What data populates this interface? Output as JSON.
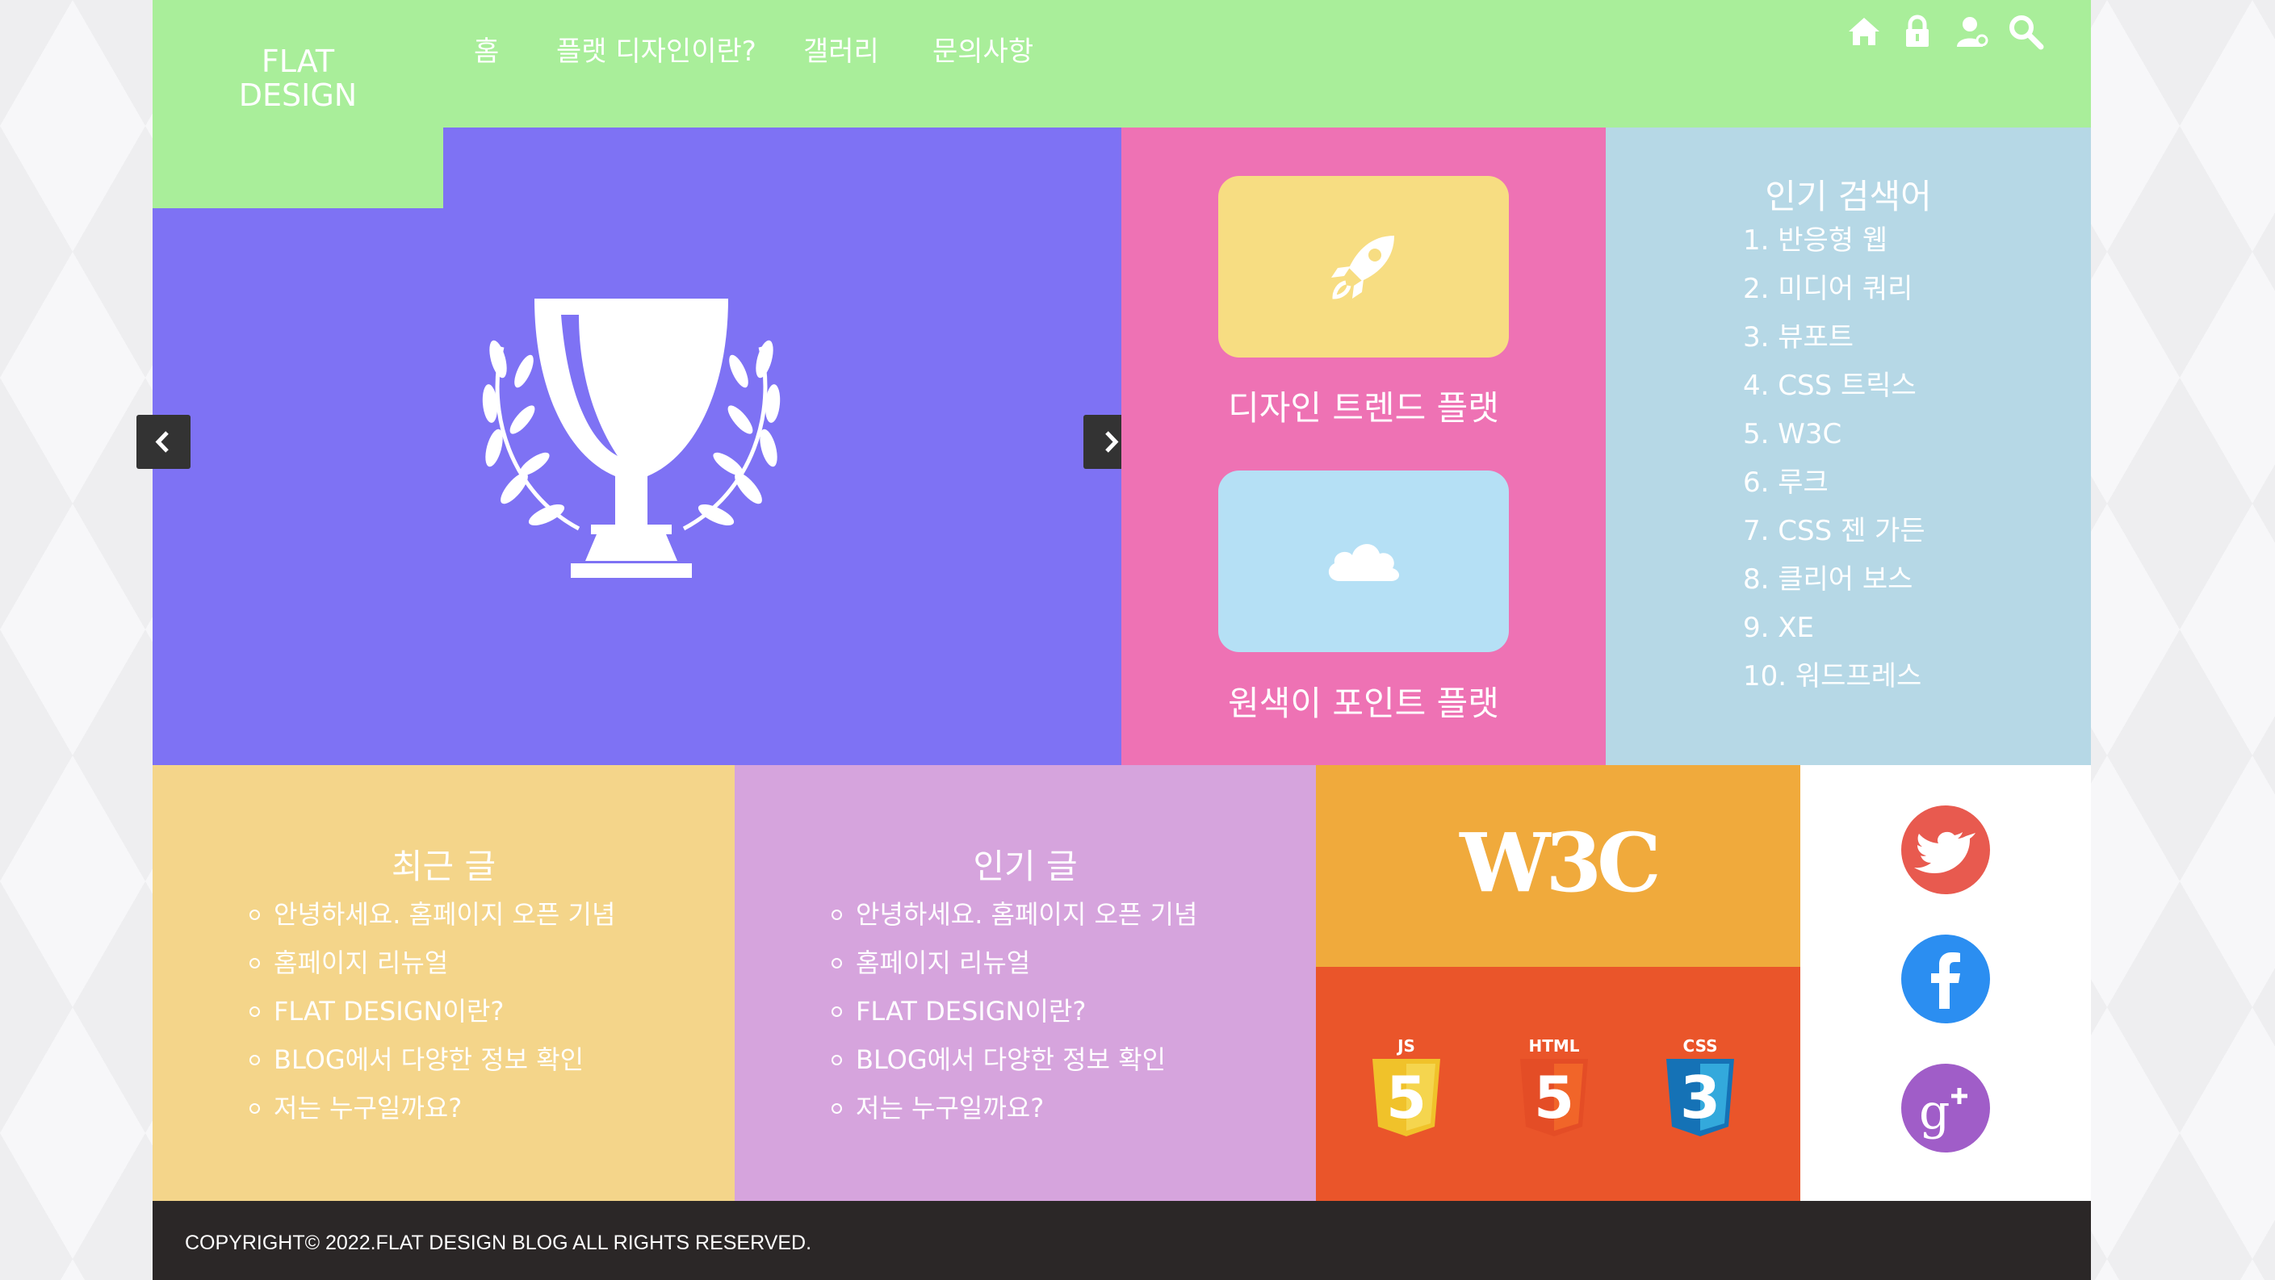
{
  "brand": {
    "line1": "FLAT",
    "line2": "DESIGN"
  },
  "nav": {
    "items": [
      "홈",
      "플랫 디자인이란?",
      "갤러리",
      "문의사항"
    ]
  },
  "header_icons": [
    "home-icon",
    "lock-icon",
    "user-icon",
    "search-icon"
  ],
  "slider": {
    "icon": "trophy-icon",
    "prev_icon": "chevron-left-icon",
    "next_icon": "chevron-right-icon"
  },
  "features": [
    {
      "label": "디자인 트렌드 플랫",
      "icon": "rocket-icon",
      "color": "#f7dd82"
    },
    {
      "label": "원색이 포인트 플랫",
      "icon": "cloud-icon",
      "color": "#b5e0f5"
    }
  ],
  "popular_search": {
    "title": "인기 검색어",
    "items": [
      "1. 반응형 웹",
      "2. 미디어 쿼리",
      "3. 뷰포트",
      "4. CSS 트릭스",
      "5. W3C",
      "6. 루크",
      "7. CSS 젠 가든",
      "8. 클리어 보스",
      "9. XE",
      "10. 워드프레스"
    ]
  },
  "recent_posts": {
    "title": "최근 글",
    "items": [
      "안녕하세요. 홈페이지 오픈 기념",
      "홈페이지 리뉴얼",
      "FLAT DESIGN이란?",
      "BLOG에서 다양한 정보 확인",
      "저는 누구일까요?"
    ]
  },
  "popular_posts": {
    "title": "인기 글",
    "items": [
      "안녕하세요. 홈페이지 오픈 기념",
      "홈페이지 리뉴얼",
      "FLAT DESIGN이란?",
      "BLOG에서 다양한 정보 확인",
      "저는 누구일까요?"
    ]
  },
  "standards": {
    "w3c": "W3C",
    "badges": [
      {
        "label": "JS",
        "number": "5"
      },
      {
        "label": "HTML",
        "number": "5"
      },
      {
        "label": "CSS",
        "number": "3"
      }
    ]
  },
  "social": [
    "twitter-icon",
    "facebook-icon",
    "google-plus-icon"
  ],
  "footer": {
    "copyright": "COPYRIGHT© 2022.FLAT DESIGN BLOG ALL RIGHTS RESERVED."
  },
  "colors": {
    "header": "#a9ee9a",
    "slider": "#7e72f4",
    "features": "#ee72b4",
    "search": "#b6d8e6",
    "recent": "#f4d58a",
    "popular": "#d6a4dd",
    "w3c": "#f0aa3c",
    "web": "#ea552a",
    "footer": "#2b2727"
  }
}
